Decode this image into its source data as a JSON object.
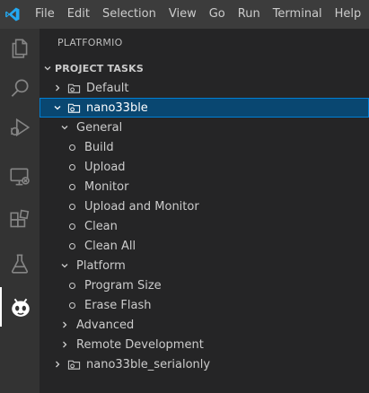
{
  "menubar": {
    "items": [
      "File",
      "Edit",
      "Selection",
      "View",
      "Go",
      "Run",
      "Terminal",
      "Help"
    ]
  },
  "activity_bar": {
    "icons": [
      "explorer-icon",
      "search-icon",
      "run-debug-icon",
      "remote-explorer-icon",
      "extensions-icon",
      "testing-icon",
      "platformio-icon"
    ],
    "active": "platformio-icon"
  },
  "sidebar": {
    "title": "PLATFORMIO",
    "section_title": "PROJECT TASKS",
    "tree": {
      "default": "Default",
      "nano33ble": "nano33ble",
      "general": "General",
      "build": "Build",
      "upload": "Upload",
      "monitor": "Monitor",
      "upload_monitor": "Upload and Monitor",
      "clean": "Clean",
      "clean_all": "Clean All",
      "platform": "Platform",
      "program_size": "Program Size",
      "erase_flash": "Erase Flash",
      "advanced": "Advanced",
      "remote_dev": "Remote Development",
      "serialonly": "nano33ble_serialonly"
    }
  },
  "colors": {
    "accent": "#0078d4",
    "selection": "#094771"
  }
}
